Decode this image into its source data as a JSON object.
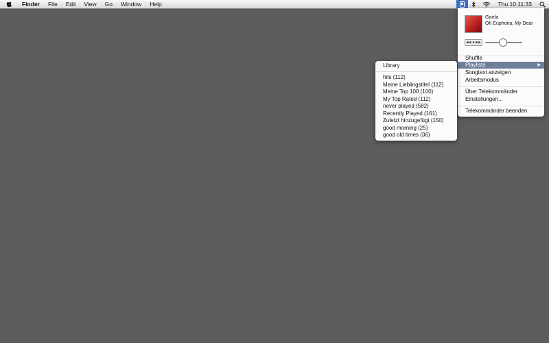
{
  "menubar": {
    "apple_icon": "apple-icon",
    "items": [
      "Finder",
      "File",
      "Edit",
      "View",
      "Go",
      "Window",
      "Help"
    ],
    "clock": "Thu 10:11:33",
    "status_icons": [
      "telekommander-icon",
      "bluetooth-icon",
      "wifi-icon",
      "spotlight-icon"
    ]
  },
  "app_menu": {
    "now_playing": {
      "artist": "Garda",
      "track": "Oh Euphoria, My Dear",
      "rating": "· · · · ·",
      "controls": [
        "◀◀",
        "■",
        "▶▶"
      ]
    },
    "items": {
      "shuffle": "Shuffle",
      "playlists": "Playlists",
      "songtext": "Songtext anzeigen",
      "work_mode": "Arbeitsmodus",
      "about": "Über Telekommänder",
      "settings": "Einstellungen...",
      "quit": "Telekommänder beenden"
    }
  },
  "playlists_menu": {
    "library": "Library",
    "playlists": [
      "hits (112)",
      "Meine Lieblingstitel (112)",
      "Meine Top 100 (100)",
      "My Top Rated (112)",
      "never played (582)",
      "Recently Played (161)",
      "Zuletzt hinzugefügt (150)",
      "good morning (25)",
      "good old times (36)"
    ]
  },
  "colors": {
    "desktop": "#5c5c5c",
    "highlight": "#6e7f9a",
    "status_active": "#3d6cc3"
  }
}
